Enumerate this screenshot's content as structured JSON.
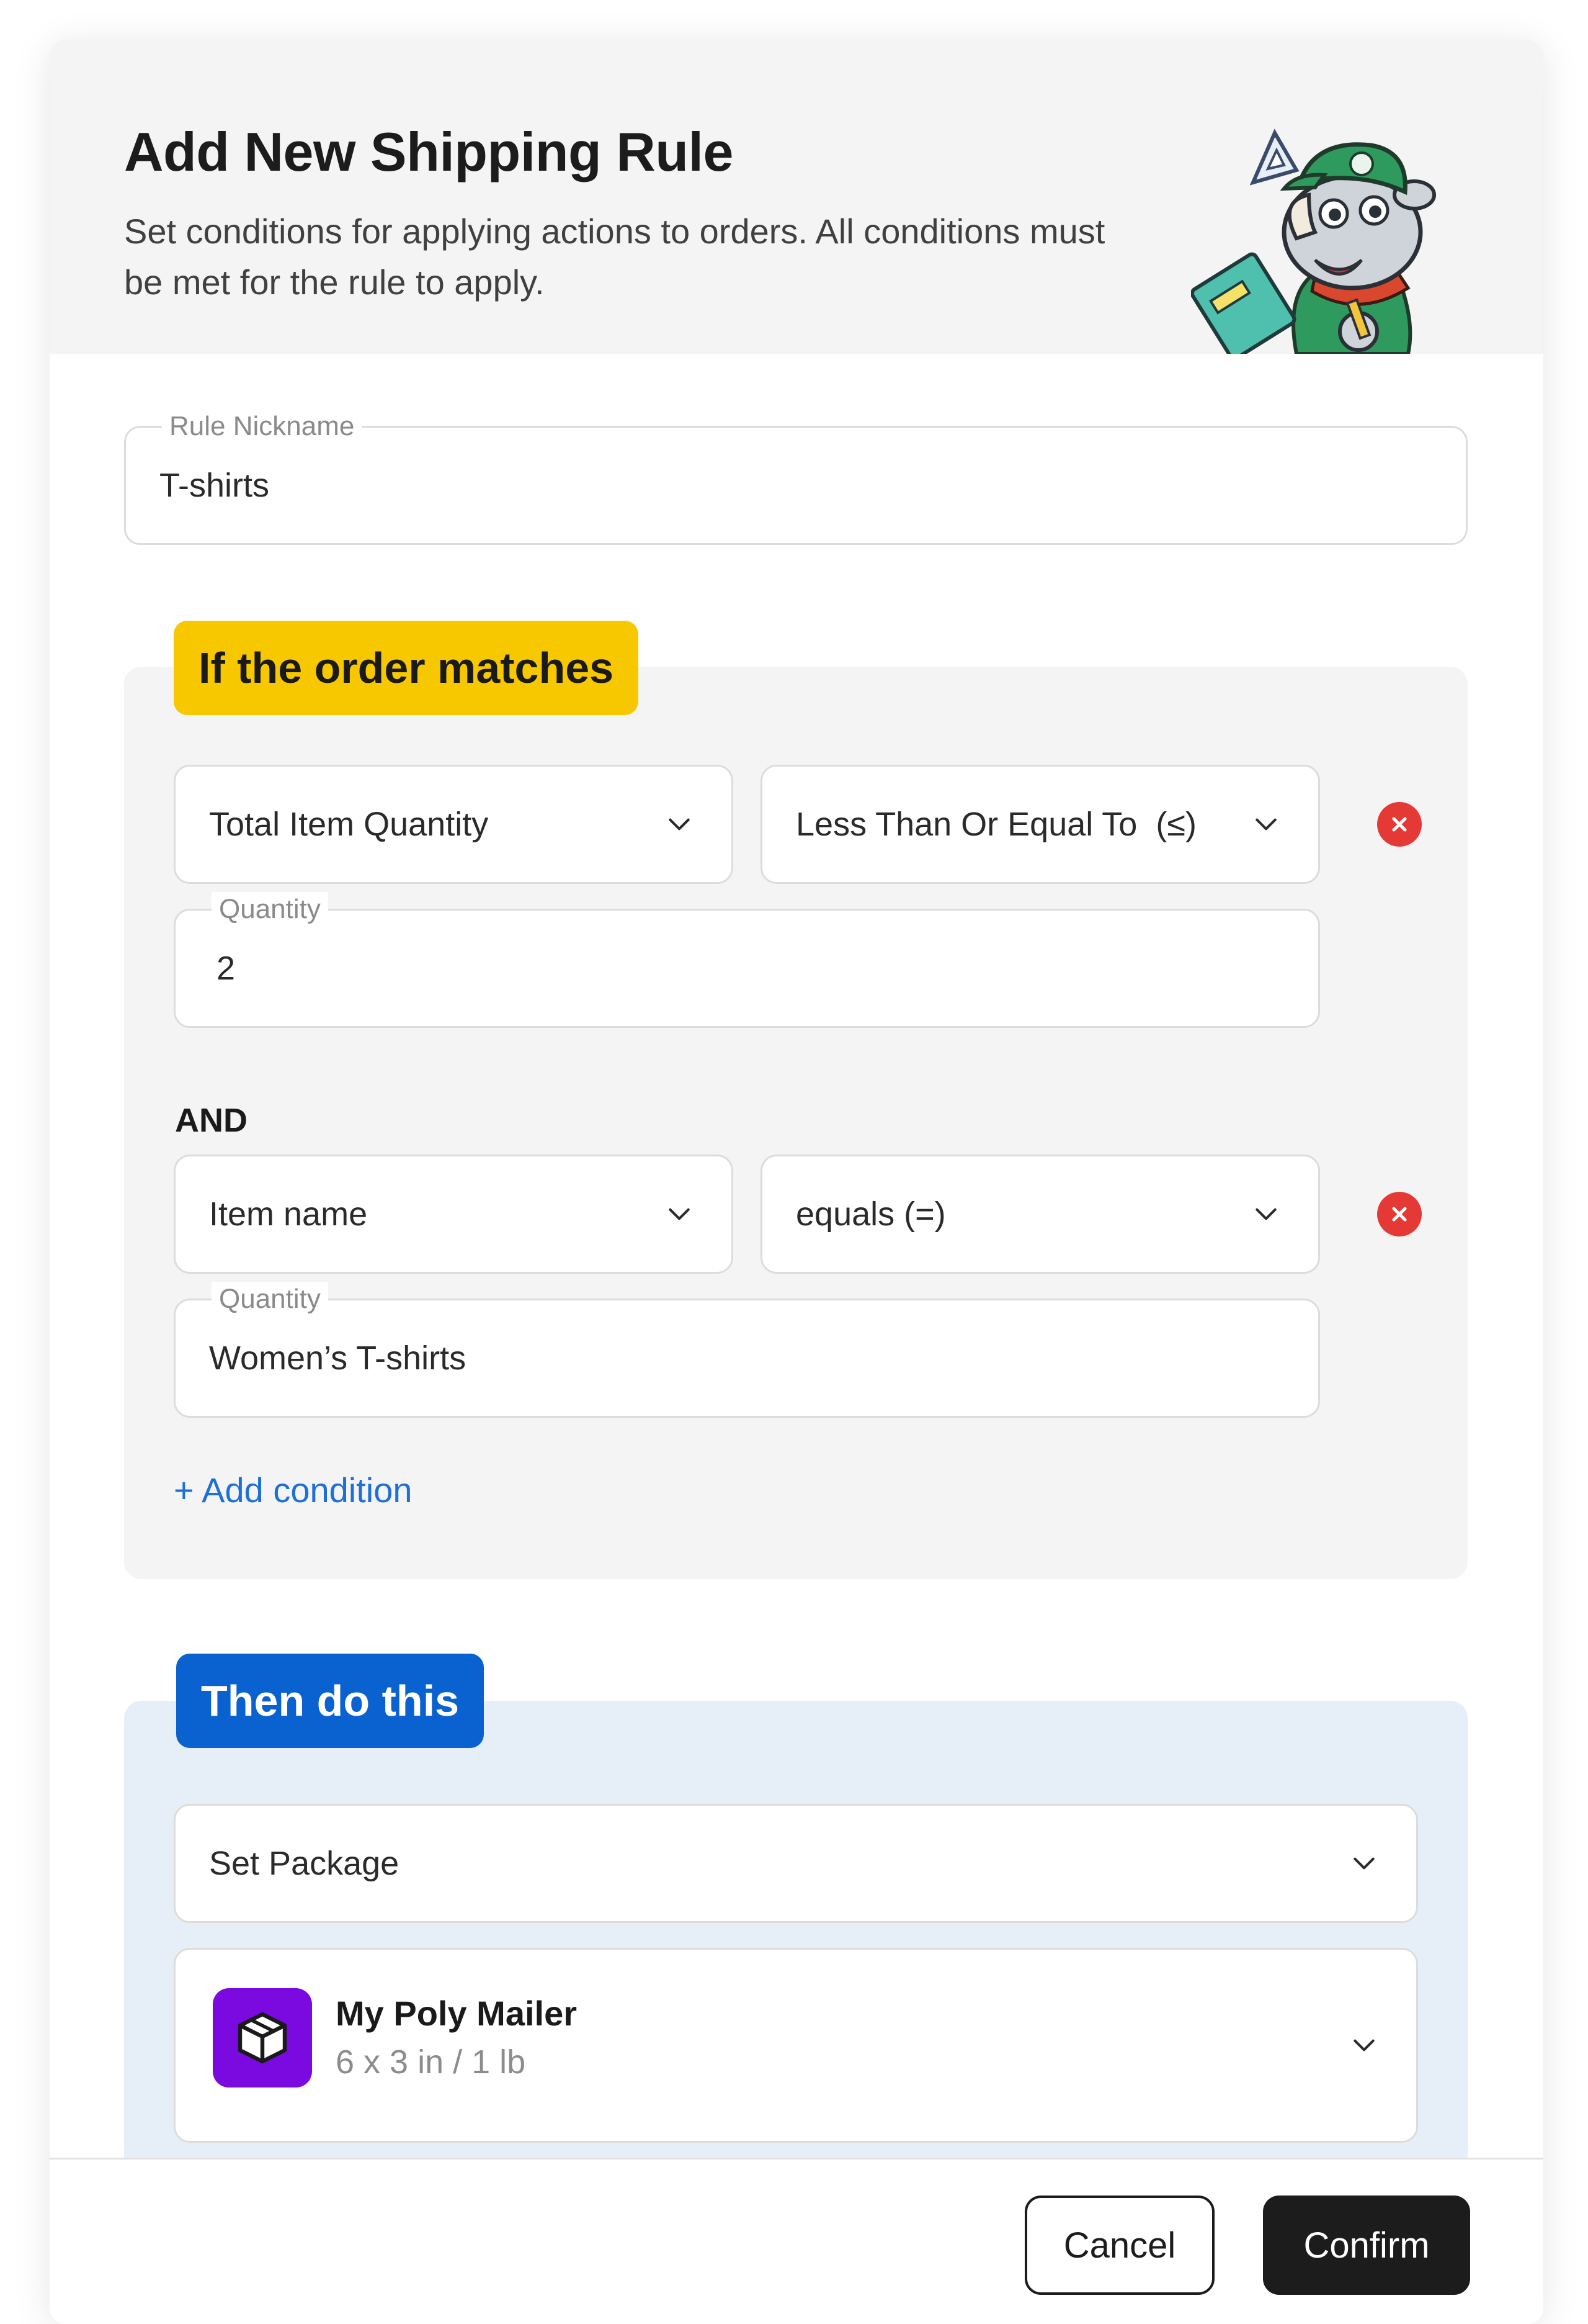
{
  "header": {
    "title": "Add New Shipping Rule",
    "subtitle": "Set conditions for applying actions to orders. All conditions must be met for the rule to apply."
  },
  "nickname": {
    "label": "Rule Nickname",
    "value": "T-shirts"
  },
  "conditions": {
    "tag": "If the order matches",
    "rows": [
      {
        "field": "Total Item Quantity",
        "operator": "Less Than Or Equal To  (≤)",
        "value_label": "Quantity",
        "value": "2"
      },
      {
        "field": "Item name",
        "operator": "equals (=)",
        "value_label": "Quantity",
        "value": "Women’s T-shirts"
      }
    ],
    "joiner": "AND",
    "add_label": "+ Add condition"
  },
  "actions": {
    "tag": "Then do this",
    "action": "Set Package",
    "package": {
      "name": "My Poly Mailer",
      "meta": "6 x 3 in / 1 lb"
    }
  },
  "footer": {
    "cancel": "Cancel",
    "confirm": "Confirm"
  },
  "colors": {
    "if_tag": "#f7c800",
    "then_tag": "#0a62d0",
    "remove": "#e53935",
    "link": "#1e6fd6",
    "package_icon": "#7a0ae0"
  }
}
